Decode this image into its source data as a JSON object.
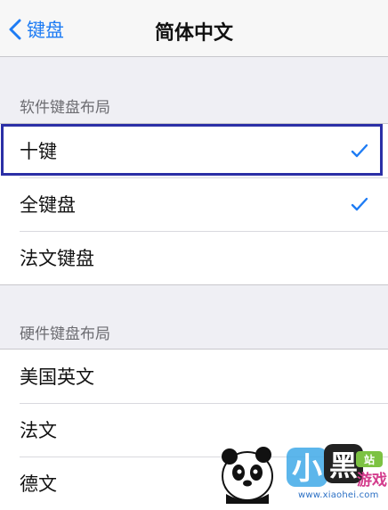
{
  "nav": {
    "back_label": "键盘",
    "title": "简体中文"
  },
  "software_section": {
    "header": "软件键盘布局",
    "items": [
      {
        "label": "十键",
        "checked": true
      },
      {
        "label": "全键盘",
        "checked": true
      },
      {
        "label": "法文键盘",
        "checked": false
      }
    ]
  },
  "hardware_section": {
    "header": "硬件键盘布局",
    "items": [
      {
        "label": "美国英文"
      },
      {
        "label": "法文"
      },
      {
        "label": "德文"
      }
    ]
  },
  "watermark": {
    "url": "www.xiaohei.com",
    "brand": "小黑游戏"
  },
  "colors": {
    "accent": "#1e7cf4",
    "highlight_border": "#2b2fa6",
    "background": "#efeff4"
  }
}
